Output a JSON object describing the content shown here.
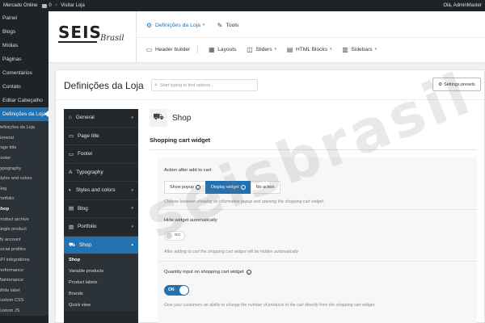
{
  "adminbar": {
    "site": "Mercado Online",
    "comments": "0",
    "visit": "Visitar Loja",
    "greeting": "Olá, AdminMaster"
  },
  "sidebar": {
    "items": [
      {
        "label": "Painel"
      },
      {
        "label": "Blogs"
      },
      {
        "label": "Mídias"
      },
      {
        "label": "Páginas"
      },
      {
        "label": "Comentários"
      },
      {
        "label": "Contato"
      },
      {
        "label": "Editar Cabeçalho"
      },
      {
        "label": "Definições da Loja"
      }
    ],
    "subitems": [
      {
        "label": "Definições da Loja"
      },
      {
        "label": "General"
      },
      {
        "label": "Page title"
      },
      {
        "label": "Footer"
      },
      {
        "label": "Typography"
      },
      {
        "label": "Styles and colors"
      },
      {
        "label": "Blog"
      },
      {
        "label": "Portfolio"
      },
      {
        "label": "Shop"
      },
      {
        "label": "Product archive"
      },
      {
        "label": "Single product"
      },
      {
        "label": "My account"
      },
      {
        "label": "Social profiles"
      },
      {
        "label": "API integrations"
      },
      {
        "label": "Performance"
      },
      {
        "label": "Maintenance"
      },
      {
        "label": "White label"
      },
      {
        "label": "Custom CSS"
      },
      {
        "label": "Custom JS"
      }
    ]
  },
  "logo": {
    "text": "SEIS",
    "script": "Brasil"
  },
  "topnav": {
    "settings": "Definições da Loja",
    "tools": "Tools"
  },
  "subnav": [
    "Header builder",
    "Layouts",
    "Sliders",
    "HTML Blocks",
    "Sidebars"
  ],
  "panel": {
    "title": "Definições da Loja",
    "search_placeholder": "Start typing to find options...",
    "presets": "Settings presets"
  },
  "optnav": {
    "items": [
      "General",
      "Page title",
      "Footer",
      "Typography",
      "Styles and colors",
      "Blog",
      "Portfolio",
      "Shop"
    ],
    "shop_subitems": [
      "Shop",
      "Variable products",
      "Product labels",
      "Brands",
      "Quick view"
    ]
  },
  "content": {
    "section_title": "Shop",
    "group_title": "Shopping cart widget",
    "after_add": {
      "label": "Action after add to cart",
      "options": [
        "Show popup",
        "Display widget",
        "No action"
      ],
      "selected": "Display widget",
      "desc": "Choose between showing an informative popup and opening the shopping cart widget."
    },
    "hide_widget": {
      "label": "Hide widget automatically",
      "toggle": "NO",
      "desc": "After adding to cart the shopping cart widget will be hidden automatically"
    },
    "quantity": {
      "label": "Quantity input on shopping cart widget",
      "toggle": "ON",
      "desc": "Give your customers an ability to change the number of products in the cart directly from the shopping cart widget."
    }
  },
  "watermark": "seisbrasil"
}
